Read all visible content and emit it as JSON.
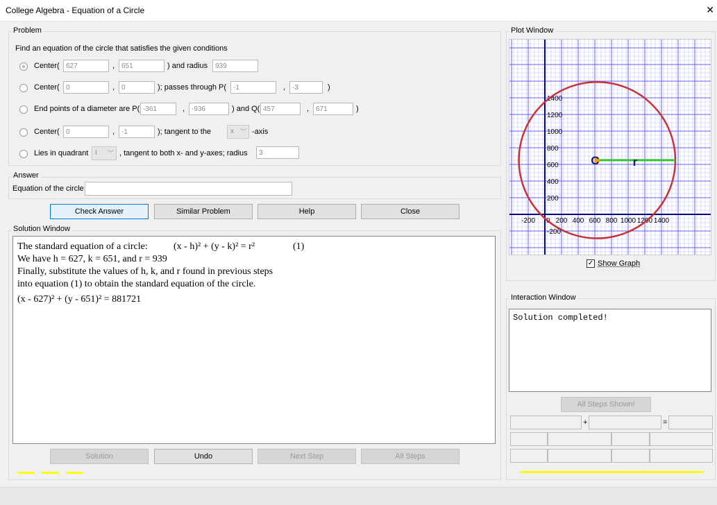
{
  "window": {
    "title": "College Algebra - Equation of a Circle",
    "close_glyph": "✕"
  },
  "problem": {
    "legend": "Problem",
    "instruction": "Find an equation of the circle that satisfies the given conditions",
    "opt1": {
      "label_center": "Center(",
      "x": "627",
      "comma": ",",
      "y": "651",
      "label_radius": ") and radius",
      "radius": "939",
      "selected": true
    },
    "opt2": {
      "label_center": "Center(",
      "x": "0",
      "comma": ",",
      "y": "0",
      "label_pass": "); passes through P(",
      "px": "-1",
      "comma2": ",",
      "py": "-3",
      "close": ")"
    },
    "opt3": {
      "label": "End points of a diameter are P(",
      "px": "-361",
      "comma": ",",
      "py": "-936",
      "label_q": ") and Q(",
      "qx": "457",
      "comma2": ",",
      "qy": "671",
      "close": ")"
    },
    "opt4": {
      "label_center": "Center(",
      "x": "0",
      "comma": ",",
      "y": "-1",
      "label_tangent": "); tangent to the",
      "axis_value": "x",
      "axis_suffix": "-axis"
    },
    "opt5": {
      "label": "Lies in quadrant",
      "quadrant": "I",
      "label_tangent": ", tangent to both x- and y-axes; radius",
      "radius": "3"
    }
  },
  "answer": {
    "legend": "Answer",
    "label": "Equation of the circle",
    "value": ""
  },
  "buttons": {
    "check": "Check Answer",
    "similar": "Similar Problem",
    "help": "Help",
    "close": "Close"
  },
  "solution": {
    "legend": "Solution Window",
    "line1_a": "The standard equation of a circle: ",
    "line1_eq": "(x - h)² + (y - k)² = r²",
    "line1_num": "(1)",
    "line2": "We have h = 627, k = 651, and r = 939",
    "line3": "Finally, substitute the values of h, k, and r found in previous steps",
    "line4": "into equation (1) to obtain the standard equation of the circle.",
    "line5": "(x - 627)² + (y - 651)² = 881721",
    "buttons": {
      "solution": "Solution",
      "undo": "Undo",
      "next": "Next Step",
      "all": "All Steps"
    }
  },
  "plot": {
    "legend": "Plot Window",
    "x_ticks": [
      "-200",
      "0",
      "200",
      "400",
      "600",
      "800",
      "1000",
      "1200",
      "1400"
    ],
    "y_ticks": [
      "1400",
      "1200",
      "1000",
      "800",
      "600",
      "400",
      "200",
      "-200"
    ],
    "center_label": "C",
    "radius_label": "r",
    "show_graph_label": "Show Graph",
    "show_graph_checked": true,
    "colors": {
      "circle": "#c83232",
      "radius": "#32c832",
      "center": "#f0a000",
      "grid": "#6060ff",
      "axes": "#000080"
    }
  },
  "interaction": {
    "legend": "Interaction Window",
    "message": "Solution completed!",
    "all_steps_button": "All Steps Shown!",
    "plus": "+",
    "equals": "="
  }
}
